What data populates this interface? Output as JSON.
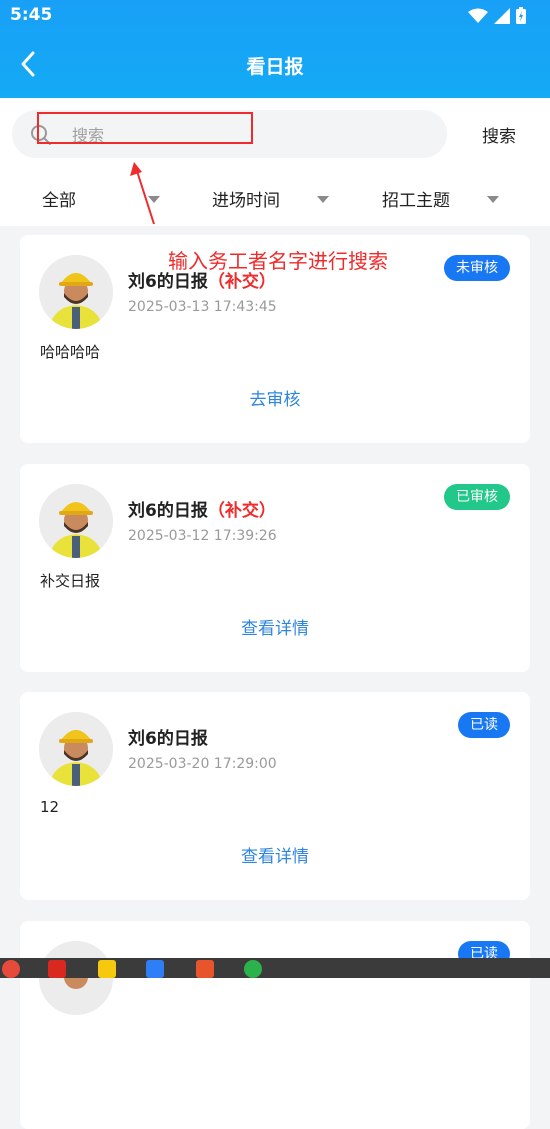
{
  "status_bar": {
    "time": "5:45"
  },
  "header": {
    "title": "看日报"
  },
  "search": {
    "placeholder": "搜索",
    "button_label": "搜索"
  },
  "filters": [
    {
      "label": "全部"
    },
    {
      "label": "进场时间"
    },
    {
      "label": "招工主题"
    }
  ],
  "annotation": {
    "text": "输入务工者名字进行搜索"
  },
  "reports": [
    {
      "title": "刘6的日报",
      "makeup": "（补交）",
      "time": "2025-03-13 17:43:45",
      "status": "未审核",
      "content": "哈哈哈哈",
      "action": "去审核"
    },
    {
      "title": "刘6的日报",
      "makeup": "（补交）",
      "time": "2025-03-12 17:39:26",
      "status": "已审核",
      "content": "补交日报",
      "action": "查看详情"
    },
    {
      "title": "刘6的日报",
      "makeup": "",
      "time": "2025-03-20 17:29:00",
      "status": "已读",
      "content": "12",
      "action": "查看详情"
    },
    {
      "title": "",
      "makeup": "",
      "time": "",
      "status": "已读",
      "content": "",
      "action": ""
    }
  ],
  "colors": {
    "header_blue": "#18a0f6",
    "badge_blue": "#1877f2",
    "badge_green": "#22c78a",
    "makeup_red": "#ef2b2b",
    "link_blue": "#2e86de"
  }
}
